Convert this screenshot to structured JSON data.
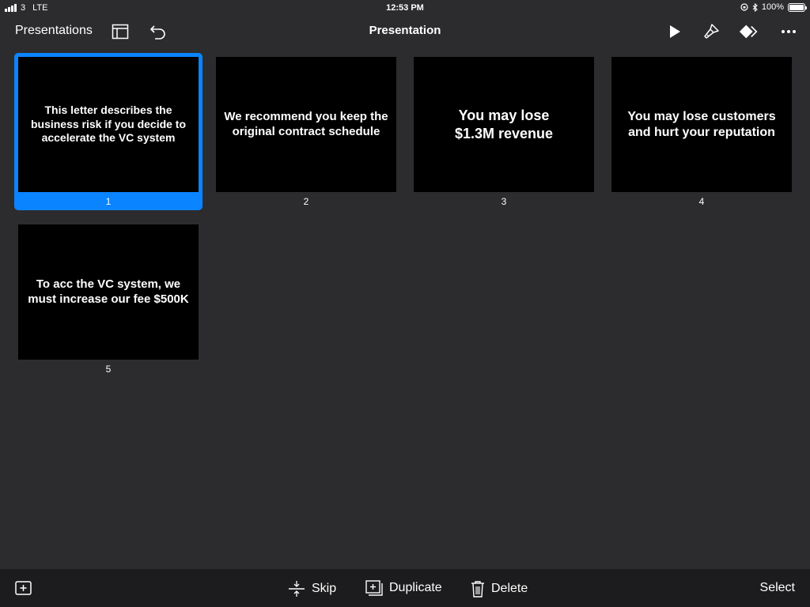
{
  "status": {
    "carrier": "3",
    "network": "LTE",
    "time": "12:53 PM",
    "battery": "100%"
  },
  "toolbar": {
    "back_label": "Presentations",
    "title": "Presentation"
  },
  "slides": [
    {
      "number": "1",
      "text": "This letter describes the business risk if you decide to accelerate the VC system",
      "selected": true
    },
    {
      "number": "2",
      "text": "We recommend you keep the original contract schedule",
      "selected": false
    },
    {
      "number": "3",
      "text": "You may lose $1.3M revenue",
      "selected": false
    },
    {
      "number": "4",
      "text": "You may lose customers and hurt your reputation",
      "selected": false
    },
    {
      "number": "5",
      "text": "To acc the VC system, we must increase our fee $500K",
      "selected": false
    }
  ],
  "bottom_bar": {
    "skip_label": "Skip",
    "duplicate_label": "Duplicate",
    "delete_label": "Delete",
    "select_label": "Select"
  },
  "colors": {
    "accent": "#0a84ff",
    "background": "#2c2c2e",
    "bottom_bar": "#1c1c1e"
  },
  "icons": [
    "add-slide-icon",
    "skip-icon",
    "duplicate-icon",
    "delete-icon",
    "play-icon",
    "format-brush-icon",
    "animate-icon",
    "more-icon",
    "layout-icon",
    "undo-icon"
  ]
}
